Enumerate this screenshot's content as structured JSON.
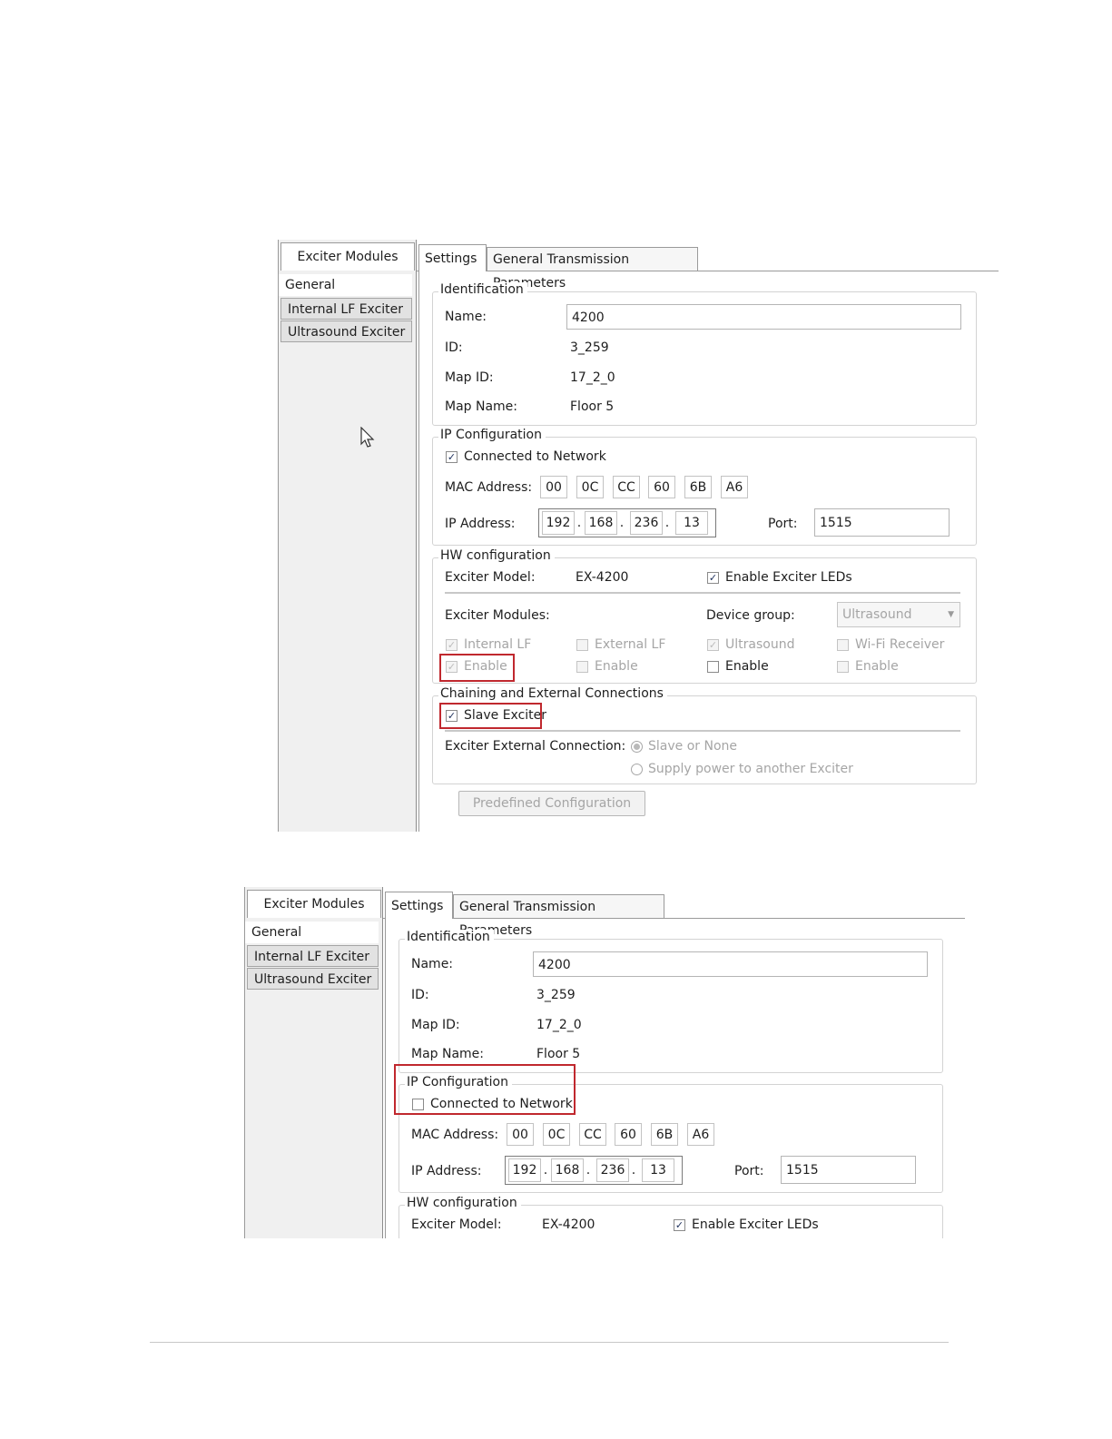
{
  "shot1": {
    "sidebar": {
      "header": "Exciter Modules",
      "items": [
        "General",
        "Internal LF Exciter",
        "Ultrasound Exciter"
      ]
    },
    "tabs": [
      "Settings",
      "General Transmission Parameters"
    ],
    "identification": {
      "legend": "Identification",
      "name_label": "Name:",
      "name_value": "4200",
      "id_label": "ID:",
      "id_value": "3_259",
      "mapid_label": "Map ID:",
      "mapid_value": "17_2_0",
      "mapname_label": "Map Name:",
      "mapname_value": "Floor 5"
    },
    "ip_config": {
      "legend": "IP Configuration",
      "connected_label": "Connected to Network",
      "connected_checked": true,
      "mac_label": "MAC Address:",
      "mac": [
        "00",
        "0C",
        "CC",
        "60",
        "6B",
        "A6"
      ],
      "ip_label": "IP Address:",
      "ip": [
        "192",
        "168",
        "236",
        "13"
      ],
      "port_label": "Port:",
      "port_value": "1515"
    },
    "hw_config": {
      "legend": "HW configuration",
      "model_label": "Exciter Model:",
      "model_value": "EX-4200",
      "leds_label": "Enable Exciter LEDs",
      "modules_label": "Exciter Modules:",
      "device_group_label": "Device group:",
      "device_group_value": "Ultrasound",
      "mod_internal_lf": "Internal LF",
      "mod_external_lf": "External LF",
      "mod_ultrasound": "Ultrasound",
      "mod_wifi": "Wi-Fi Receiver",
      "enable": "Enable"
    },
    "chaining": {
      "legend": "Chaining and External Connections",
      "slave_label": "Slave Exciter",
      "ext_label": "Exciter External Connection:",
      "opt1": "Slave or None",
      "opt2": "Supply power to another Exciter"
    },
    "predefined_button": "Predefined Configuration"
  },
  "shot2": {
    "sidebar": {
      "header": "Exciter Modules",
      "items": [
        "General",
        "Internal LF Exciter",
        "Ultrasound Exciter"
      ]
    },
    "tabs": [
      "Settings",
      "General Transmission Parameters"
    ],
    "identification": {
      "legend": "Identification",
      "name_label": "Name:",
      "name_value": "4200",
      "id_label": "ID:",
      "id_value": "3_259",
      "mapid_label": "Map ID:",
      "mapid_value": "17_2_0",
      "mapname_label": "Map Name:",
      "mapname_value": "Floor 5"
    },
    "ip_config": {
      "legend": "IP Configuration",
      "connected_label": "Connected to Network",
      "connected_checked": false,
      "mac_label": "MAC Address:",
      "mac": [
        "00",
        "0C",
        "CC",
        "60",
        "6B",
        "A6"
      ],
      "ip_label": "IP Address:",
      "ip": [
        "192",
        "168",
        "236",
        "13"
      ],
      "port_label": "Port:",
      "port_value": "1515"
    },
    "hw_config": {
      "legend": "HW configuration",
      "model_label": "Exciter Model:",
      "model_value": "EX-4200",
      "leds_label": "Enable Exciter LEDs"
    }
  },
  "colors": {
    "highlight": "#c0282e",
    "check": "#20325e",
    "disabled_text": "#a5a5a5"
  },
  "icons": [
    "checkbox-checked",
    "checkbox-unchecked",
    "radio-button",
    "dropdown-arrow",
    "mouse-pointer"
  ]
}
